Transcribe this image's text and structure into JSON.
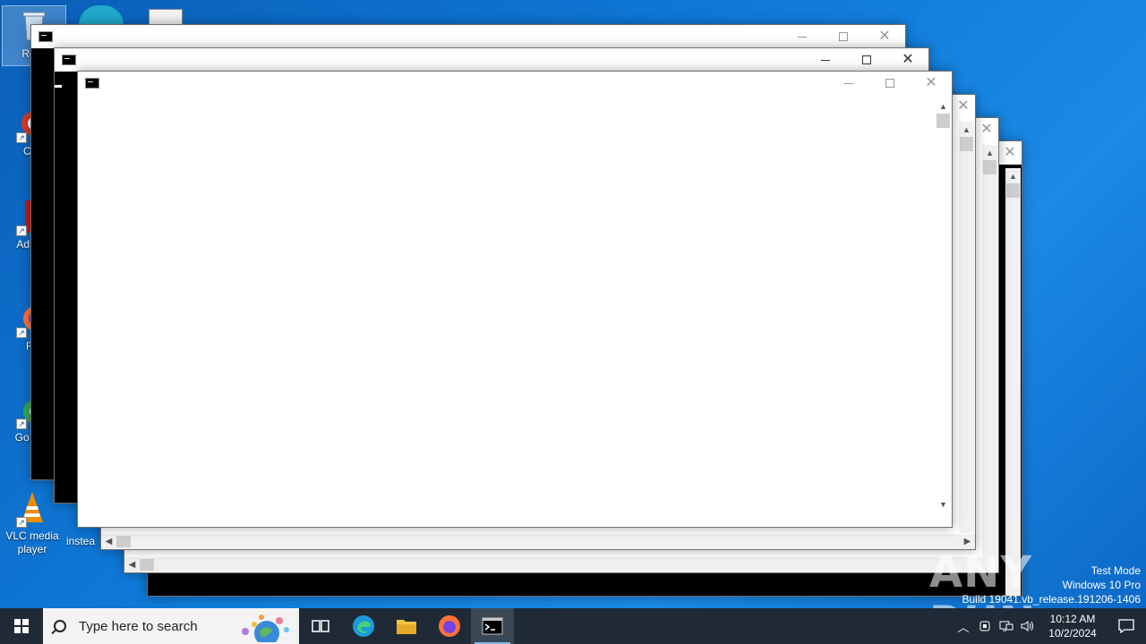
{
  "desktop": {
    "icons": [
      {
        "label": "Recy",
        "icon": "recycle-bin-icon"
      },
      {
        "label": "CCl",
        "icon": "ccleaner-icon"
      },
      {
        "label": "Ad Acr",
        "icon": "adobe-acrobat-icon"
      },
      {
        "label": "Fir",
        "icon": "firefox-icon"
      },
      {
        "label": "Go Chr",
        "icon": "chrome-icon"
      },
      {
        "label": "VLC media player",
        "icon": "vlc-icon"
      },
      {
        "label": "instea",
        "icon": "file-icon"
      }
    ]
  },
  "watermark": {
    "brand": "ANY RUN",
    "line1": "Test Mode",
    "line2": "Windows 10 Pro",
    "line3": "Build 19041.vb_release.191206-1406"
  },
  "windows": {
    "buttons": {
      "minimize": "—",
      "maximize": "☐",
      "close": "✕"
    }
  },
  "taskbar": {
    "search_placeholder": "Type here to search",
    "pinned": [
      "task-view-icon",
      "edge-icon",
      "file-explorer-icon",
      "firefox-icon",
      "cmd-icon"
    ],
    "active_app": "cmd-icon",
    "clock_time": "10:12 AM",
    "clock_date": "10/2/2024"
  },
  "colors": {
    "desktop": "#0f78d6",
    "taskbar": "#1f2a36",
    "console": "#000000"
  }
}
